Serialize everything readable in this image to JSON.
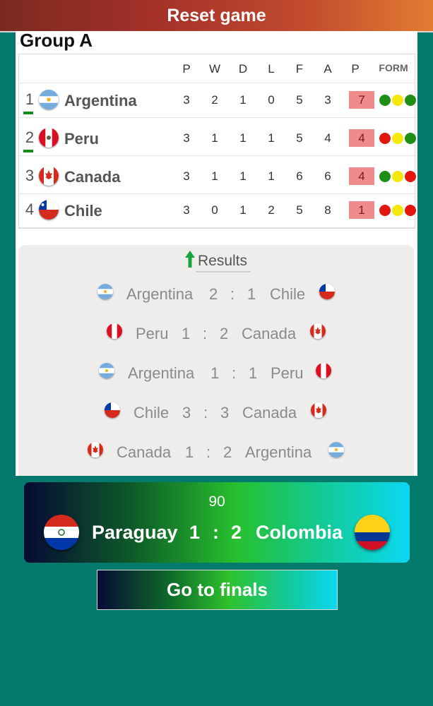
{
  "header": {
    "reset_label": "Reset game"
  },
  "group": {
    "title": "Group A",
    "columns": [
      "P",
      "W",
      "D",
      "L",
      "F",
      "A",
      "P"
    ],
    "form_label": "FORM",
    "teams": [
      {
        "pos": "1",
        "name": "Argentina",
        "stats": [
          "3",
          "2",
          "1",
          "0",
          "5",
          "3"
        ],
        "pts": "7",
        "qualified": true,
        "form": [
          "#1e8f14",
          "#f4e90a",
          "#1e8f14"
        ],
        "flag": "argentina-flag-icon"
      },
      {
        "pos": "2",
        "name": "Peru",
        "stats": [
          "3",
          "1",
          "1",
          "1",
          "5",
          "4"
        ],
        "pts": "4",
        "qualified": true,
        "form": [
          "#e2160e",
          "#f4e90a",
          "#1e8f14"
        ],
        "flag": "peru-flag-icon"
      },
      {
        "pos": "3",
        "name": "Canada",
        "stats": [
          "3",
          "1",
          "1",
          "1",
          "6",
          "6"
        ],
        "pts": "4",
        "qualified": false,
        "form": [
          "#1e8f14",
          "#f4e90a",
          "#e2160e"
        ],
        "flag": "canada-flag-icon"
      },
      {
        "pos": "4",
        "name": "Chile",
        "stats": [
          "3",
          "0",
          "1",
          "2",
          "5",
          "8"
        ],
        "pts": "1",
        "qualified": false,
        "form": [
          "#e2160e",
          "#f4e90a",
          "#e2160e"
        ],
        "flag": "chile-flag-icon"
      }
    ]
  },
  "results": {
    "title": "Results",
    "icon": "arrow-up-icon",
    "matches": [
      {
        "home": "Argentina",
        "home_score": "2",
        "away_score": "1",
        "away": "Chile"
      },
      {
        "home": "Peru",
        "home_score": "1",
        "away_score": "2",
        "away": "Canada"
      },
      {
        "home": "Argentina",
        "home_score": "1",
        "away_score": "1",
        "away": "Peru"
      },
      {
        "home": "Chile",
        "home_score": "3",
        "away_score": "3",
        "away": "Canada"
      },
      {
        "home": "Canada",
        "home_score": "1",
        "away_score": "2",
        "away": "Argentina"
      }
    ]
  },
  "live_match": {
    "minute": "90",
    "home": "Paraguay",
    "home_score": "1",
    "separator": ":",
    "away_score": "2",
    "away": "Colombia"
  },
  "finals_button": {
    "label": "Go to finals"
  },
  "colors": {
    "accent_green": "#188a1b",
    "points_bg": "#ef8b8b",
    "page_bg": "#047a6c"
  }
}
